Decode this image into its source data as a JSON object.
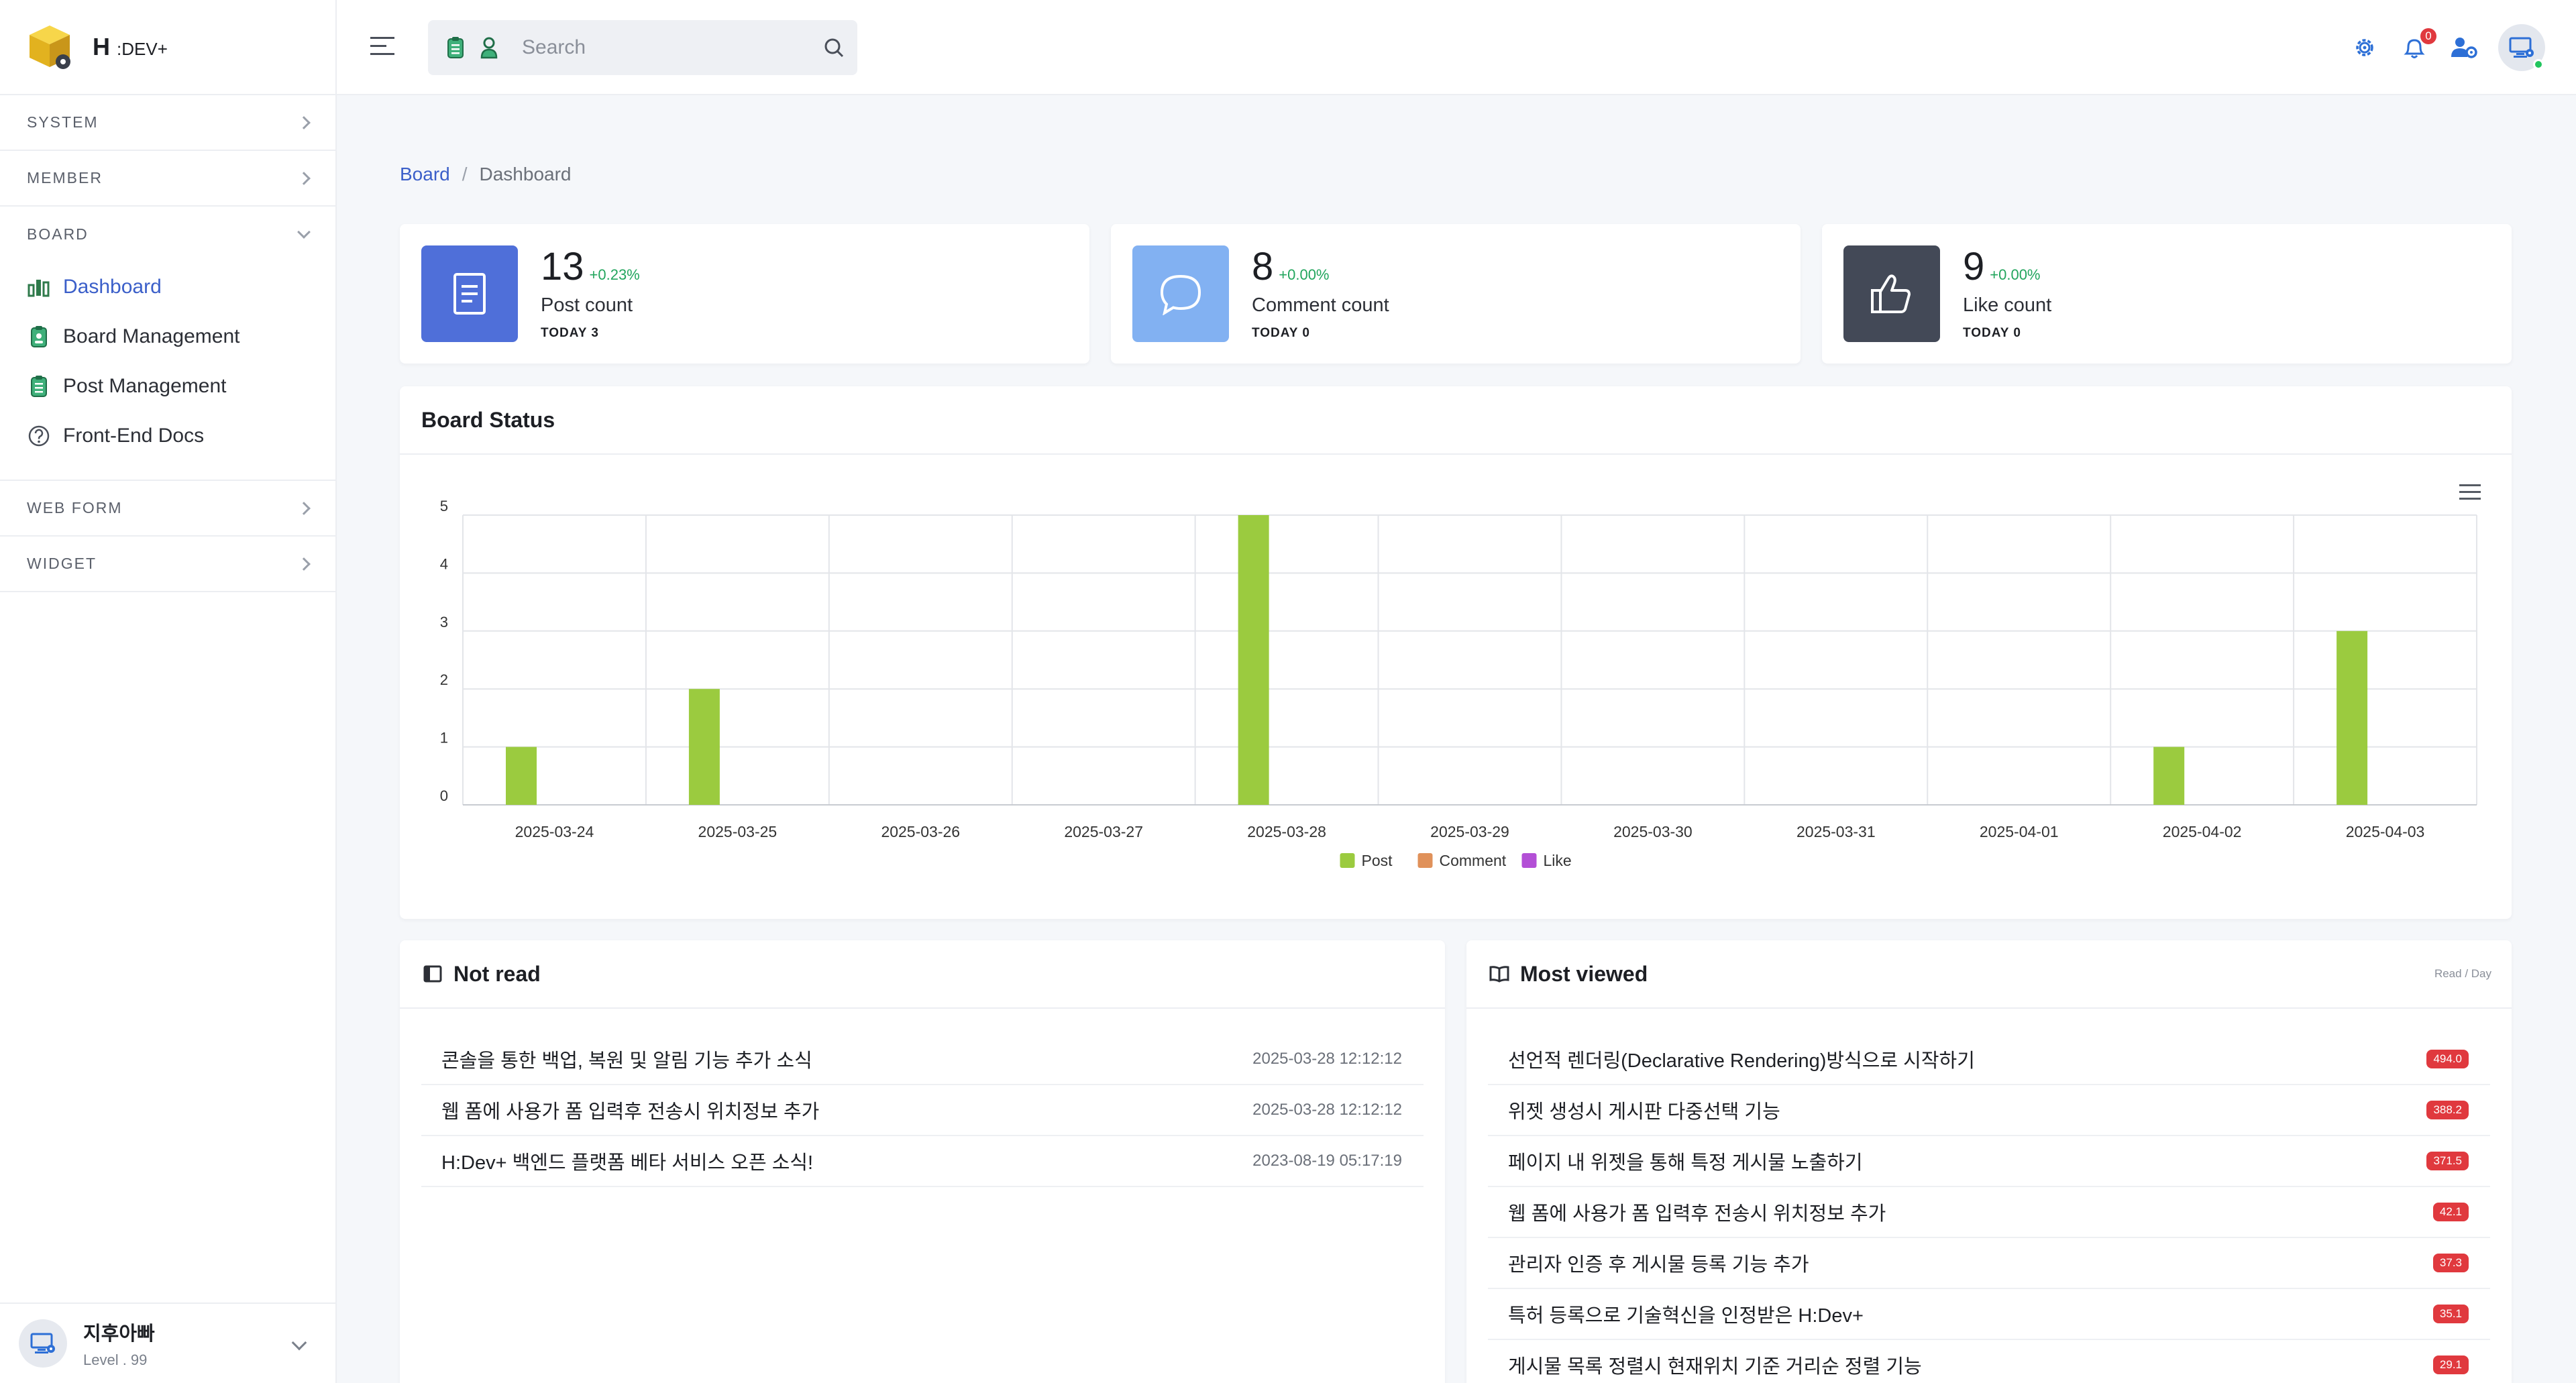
{
  "brand": {
    "title": "H",
    "suffix": ":DEV+"
  },
  "sidebar": {
    "sections": [
      {
        "label": "SYSTEM"
      },
      {
        "label": "MEMBER"
      },
      {
        "label": "BOARD"
      },
      {
        "label": "WEB FORM"
      },
      {
        "label": "WIDGET"
      }
    ],
    "board_items": [
      {
        "label": "Dashboard",
        "icon": "bar-chart-icon"
      },
      {
        "label": "Board Management",
        "icon": "clipboard-icon"
      },
      {
        "label": "Post Management",
        "icon": "document-list-icon"
      },
      {
        "label": "Front-End Docs",
        "icon": "help-circle-icon"
      }
    ],
    "user": {
      "name": "지후아빠",
      "level": "Level . 99"
    }
  },
  "topbar": {
    "search_placeholder": "Search",
    "notification_count": "0"
  },
  "breadcrumb": {
    "parent": "Board",
    "separator": "/",
    "current": "Dashboard"
  },
  "stats": [
    {
      "value": "13",
      "delta": "+0.23%",
      "label": "Post count",
      "today": "TODAY 3",
      "color": "#4f6fd9",
      "icon": "document-icon"
    },
    {
      "value": "8",
      "delta": "+0.00%",
      "label": "Comment count",
      "today": "TODAY 0",
      "color": "#82b1f2",
      "icon": "speech-bubble-icon"
    },
    {
      "value": "9",
      "delta": "+0.00%",
      "label": "Like count",
      "today": "TODAY 0",
      "color": "#434957",
      "icon": "thumbs-up-icon"
    }
  ],
  "board_status": {
    "title": "Board Status",
    "chart_data": {
      "type": "bar",
      "categories": [
        "2025-03-24",
        "2025-03-25",
        "2025-03-26",
        "2025-03-27",
        "2025-03-28",
        "2025-03-29",
        "2025-03-30",
        "2025-03-31",
        "2025-04-01",
        "2025-04-02",
        "2025-04-03"
      ],
      "series": [
        {
          "name": "Post",
          "color": "#9bcb3f",
          "values": [
            1,
            2,
            0,
            0,
            5,
            0,
            0,
            0,
            0,
            1,
            3
          ]
        },
        {
          "name": "Comment",
          "color": "#e0915a",
          "values": [
            0,
            0,
            0,
            0,
            0,
            0,
            0,
            0,
            0,
            0,
            0
          ]
        },
        {
          "name": "Like",
          "color": "#b34fd6",
          "values": [
            0,
            0,
            0,
            0,
            0,
            0,
            0,
            0,
            0,
            0,
            0
          ]
        }
      ],
      "yticks": [
        0,
        1,
        2,
        3,
        4,
        5
      ],
      "ylim": [
        0,
        5
      ],
      "grid": true,
      "legend": "bottom-center"
    }
  },
  "not_read": {
    "title": "Not read",
    "items": [
      {
        "title": "콘솔을 통한 백업, 복원 및 알림 기능 추가 소식",
        "date": "2025-03-28 12:12:12"
      },
      {
        "title": "웹 폼에 사용가 폼 입력후 전송시 위치정보 추가",
        "date": "2025-03-28 12:12:12"
      },
      {
        "title": "H:Dev+ 백엔드 플랫폼 베타 서비스 오픈 소식!",
        "date": "2023-08-19 05:17:19"
      }
    ]
  },
  "most_viewed": {
    "title": "Most viewed",
    "subtitle": "Read / Day",
    "items": [
      {
        "title": "선언적 렌더링(Declarative Rendering)방식으로 시작하기",
        "count": "494.0"
      },
      {
        "title": "위젯 생성시 게시판 다중선택 기능",
        "count": "388.2"
      },
      {
        "title": "페이지 내 위젯을 통해 특정 게시물 노출하기",
        "count": "371.5"
      },
      {
        "title": "웹 폼에 사용가 폼 입력후 전송시 위치정보 추가",
        "count": "42.1"
      },
      {
        "title": "관리자 인증 후 게시물 등록 기능 추가",
        "count": "37.3"
      },
      {
        "title": "특허 등록으로 기술혁신을 인정받은 H:Dev+",
        "count": "35.1"
      },
      {
        "title": "게시물 목록 정렬시 현재위치 기준 거리순 정렬 기능",
        "count": "29.1"
      }
    ]
  }
}
